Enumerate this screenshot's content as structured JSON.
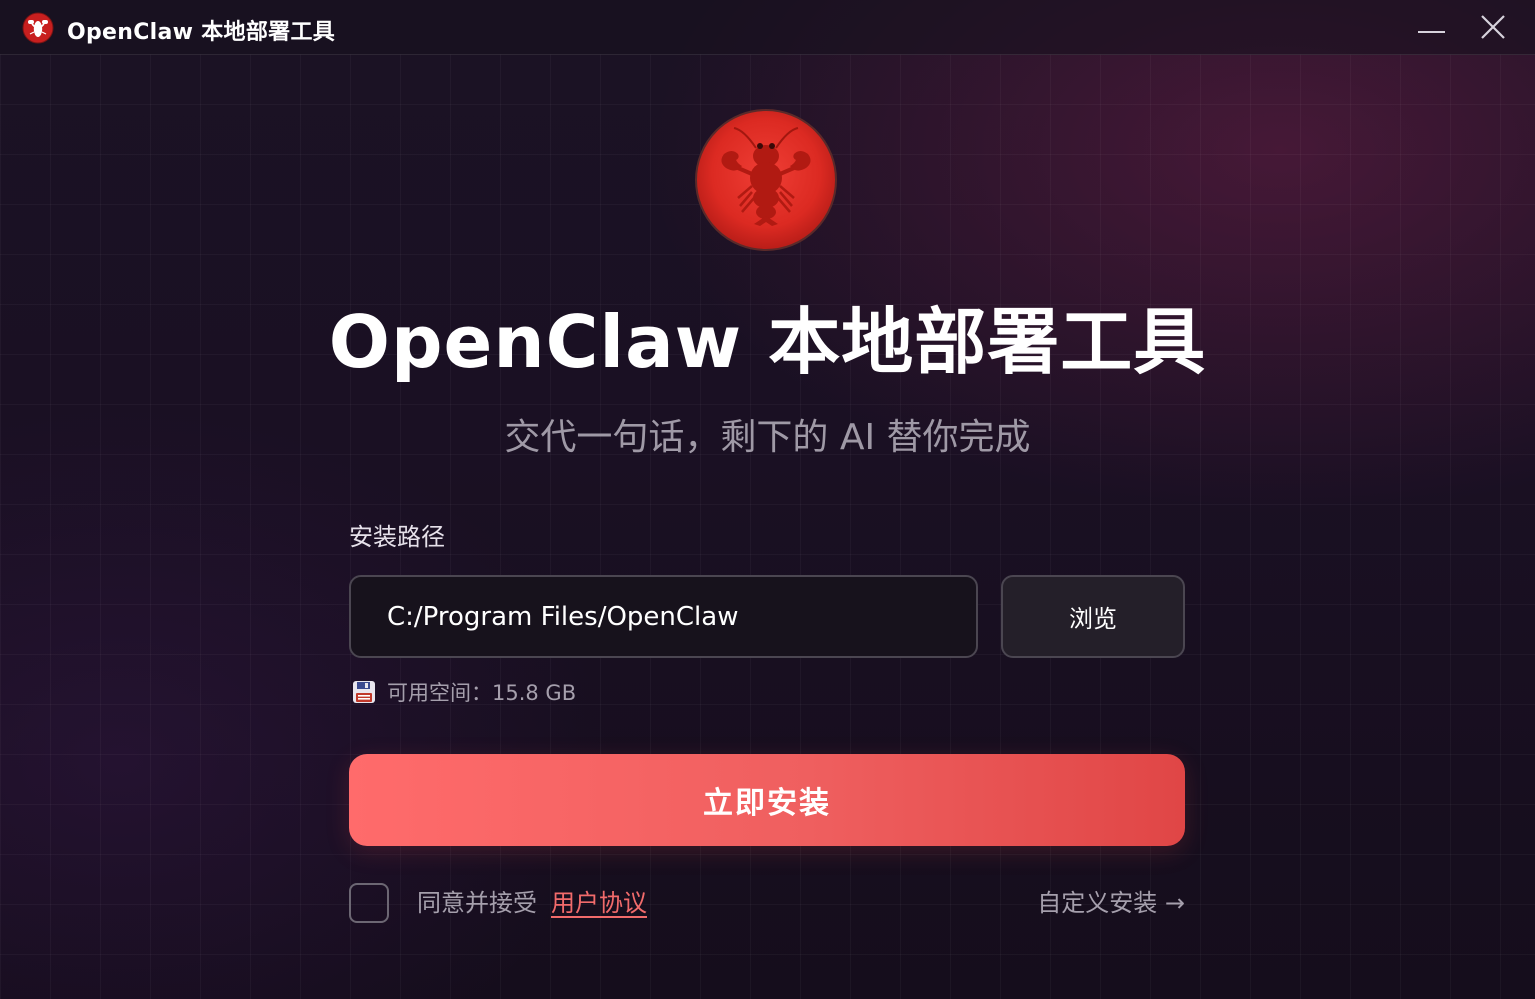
{
  "window": {
    "title": "OpenClaw 本地部署工具",
    "logo_icon": "lobster-icon",
    "minimize_icon": "minimize-icon",
    "close_icon": "close-icon"
  },
  "hero": {
    "logo_icon": "lobster-icon",
    "title": "OpenClaw 本地部署工具",
    "subtitle": "交代一句话，剩下的 AI 替你完成"
  },
  "install_path": {
    "label": "安装路径",
    "value": "C:/Program Files/OpenClaw",
    "browse_label": "浏览"
  },
  "disk": {
    "icon": "floppy-disk-icon",
    "available_text": "可用空间：15.8 GB"
  },
  "install_button": {
    "label": "立即安装"
  },
  "agreement": {
    "checked": false,
    "text": "同意并接受",
    "link_label": "用户协议"
  },
  "custom_install": {
    "label": "自定义安装 →"
  },
  "colors": {
    "accent": "#f26b6b",
    "button_start": "#ff6b6b",
    "button_end": "#e04646",
    "background": "#1a1023",
    "logo_red": "#d42a1e"
  }
}
